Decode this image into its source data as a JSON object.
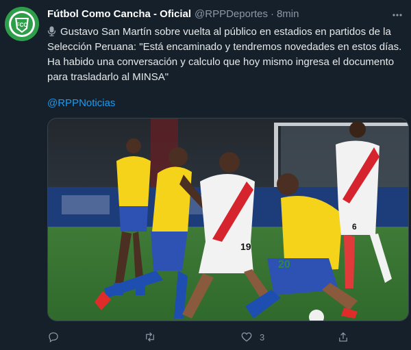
{
  "tweet": {
    "display_name": "Fútbol Como Cancha - Oficial",
    "handle": "@RPPDeportes",
    "separator": "·",
    "time": "8min",
    "text_lines": [
      "Gustavo San Martín sobre vuelta al público en estadios en partidos de la",
      "Selección Peruana: \"Está encaminado y tendremos novedades en estos días.",
      "Ha habido una conversación y calculo que hoy mismo ingresa el documento",
      "para trasladarlo al MINSA\""
    ],
    "mention": "@RPPNoticias",
    "avatar_text": "FCC",
    "media": {
      "jersey_numbers": [
        "19",
        "20",
        "6"
      ]
    },
    "actions": {
      "reply_count": "",
      "retweet_count": "",
      "like_count": "3",
      "share_count": ""
    }
  },
  "colors": {
    "background": "#15202b",
    "link": "#1d9bf0",
    "muted": "#8b98a5",
    "avatar_green": "#2e9e4a"
  }
}
